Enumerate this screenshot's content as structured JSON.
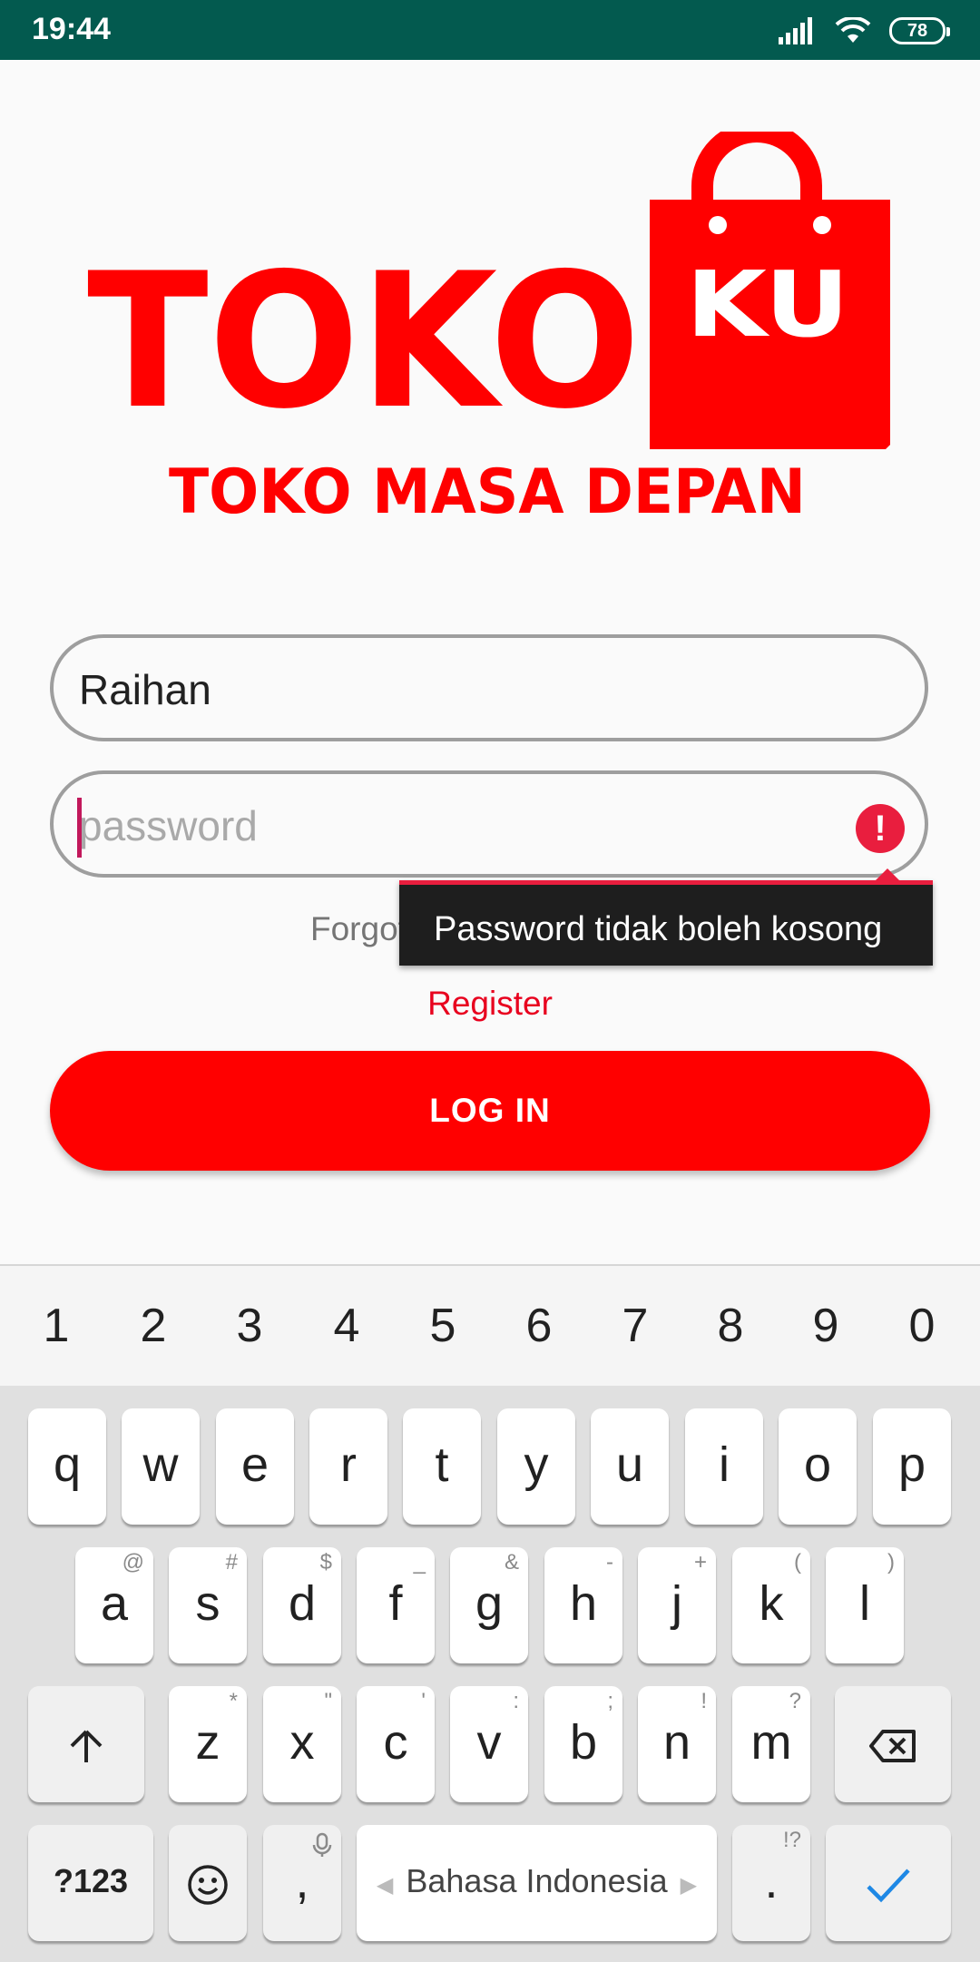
{
  "status_bar": {
    "time": "19:44",
    "battery": "78",
    "signal_icon": "signal-icon",
    "wifi_icon": "wifi-icon"
  },
  "logo": {
    "word": "TOKO",
    "badge": "KU",
    "tagline": "TOKO MASA DEPAN",
    "color": "#ff0000"
  },
  "form": {
    "username_value": "Raihan",
    "password_placeholder": "password",
    "error_message": "Password tidak boleh kosong",
    "forgot_label": "Forgot your password?",
    "register_label": "Register",
    "login_label": "LOG IN"
  },
  "colors": {
    "accent": "#ff0000",
    "status_bar": "#035a4f",
    "error": "#e91e3e"
  },
  "keyboard": {
    "numbers": [
      "1",
      "2",
      "3",
      "4",
      "5",
      "6",
      "7",
      "8",
      "9",
      "0"
    ],
    "row1": [
      "q",
      "w",
      "e",
      "r",
      "t",
      "y",
      "u",
      "i",
      "o",
      "p"
    ],
    "row2": [
      {
        "k": "a",
        "h": "@"
      },
      {
        "k": "s",
        "h": "#"
      },
      {
        "k": "d",
        "h": "$"
      },
      {
        "k": "f",
        "h": "_"
      },
      {
        "k": "g",
        "h": "&"
      },
      {
        "k": "h",
        "h": "-"
      },
      {
        "k": "j",
        "h": "+"
      },
      {
        "k": "k",
        "h": "("
      },
      {
        "k": "l",
        "h": ")"
      }
    ],
    "row3": [
      {
        "k": "z",
        "h": "*"
      },
      {
        "k": "x",
        "h": "\""
      },
      {
        "k": "c",
        "h": "'"
      },
      {
        "k": "v",
        "h": ":"
      },
      {
        "k": "b",
        "h": ";"
      },
      {
        "k": "n",
        "h": "!"
      },
      {
        "k": "m",
        "h": "?"
      }
    ],
    "symbols_key": "?123",
    "comma_key": ",",
    "space_label": "Bahasa Indonesia",
    "period_key": ".",
    "period_hint": "!?"
  }
}
